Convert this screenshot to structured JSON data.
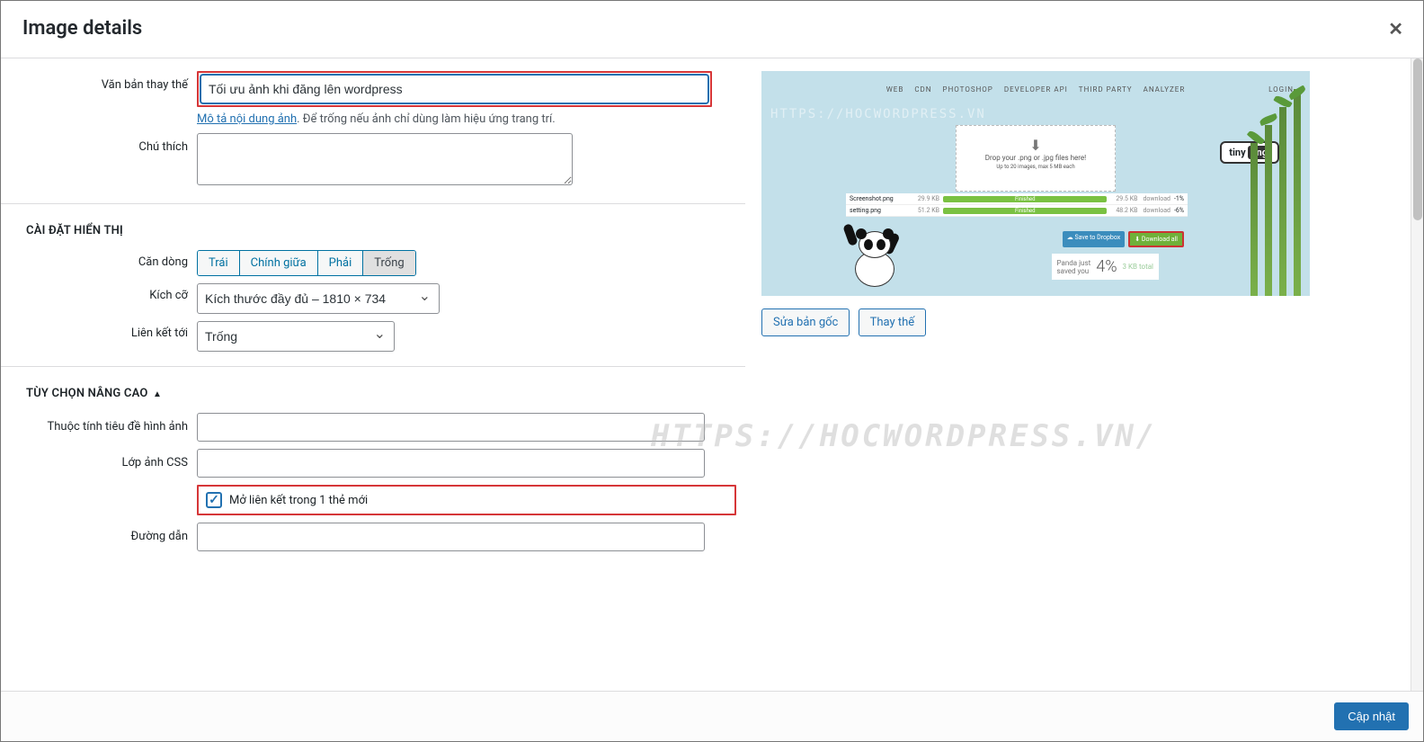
{
  "modal": {
    "title": "Image details",
    "watermark": "HTTPS://HOCWORDPRESS.VN/"
  },
  "form": {
    "altLabel": "Văn bản thay thế",
    "altValue": "Tối ưu ảnh khi đăng lên wordpress",
    "altHelpLink": "Mô tả nội dung ảnh",
    "altHelpRest": ". Để trống nếu ảnh chỉ dùng làm hiệu ứng trang trí.",
    "captionLabel": "Chú thích",
    "captionValue": ""
  },
  "display": {
    "sectionTitle": "CÀI ĐẶT HIỂN THỊ",
    "alignLabel": "Căn dòng",
    "alignOptions": {
      "left": "Trái",
      "center": "Chính giữa",
      "right": "Phải",
      "none": "Trống"
    },
    "sizeLabel": "Kích cỡ",
    "sizeValue": "Kích thước đầy đủ – 1810 × 734",
    "linkLabel": "Liên kết tới",
    "linkValue": "Trống"
  },
  "advanced": {
    "sectionTitle": "TÙY CHỌN NÂNG CAO",
    "titleAttrLabel": "Thuộc tính tiêu đề hình ảnh",
    "titleAttrValue": "",
    "cssLabel": "Lớp ảnh CSS",
    "cssValue": "",
    "newTabLabel": "Mở liên kết trong 1 thẻ mới",
    "newTabChecked": true,
    "urlLabel": "Đường dẫn",
    "urlValue": ""
  },
  "preview": {
    "nav": {
      "web": "WEB",
      "cdn": "CDN",
      "ps": "PHOTOSHOP",
      "api": "DEVELOPER API",
      "tp": "THIRD PARTY",
      "an": "ANALYZER",
      "login": "LOGIN"
    },
    "watermark": "HTTPS://HOCWORDPRESS.VN",
    "dropzone": {
      "line1": "Drop your .png or .jpg files here!",
      "line2": "Up to 20 images, max 5 MB each"
    },
    "badge": "tiny png",
    "files": [
      {
        "name": "Screenshot.png",
        "inSize": "29.9 KB",
        "status": "Finished",
        "outSize": "29.5 KB",
        "dl": "download",
        "pct": "-1%"
      },
      {
        "name": "setting.png",
        "inSize": "51.2 KB",
        "status": "Finished",
        "outSize": "48.2 KB",
        "dl": "download",
        "pct": "-6%"
      }
    ],
    "saveDropbox": "Save to Dropbox",
    "downloadAll": "Download all",
    "pandaText1": "Panda just",
    "pandaText2": "saved you",
    "pandaPct": "4%",
    "pandaTotal": "3 KB total",
    "editBtn": "Sửa bản gốc",
    "replaceBtn": "Thay thế"
  },
  "footer": {
    "update": "Cập nhật"
  }
}
